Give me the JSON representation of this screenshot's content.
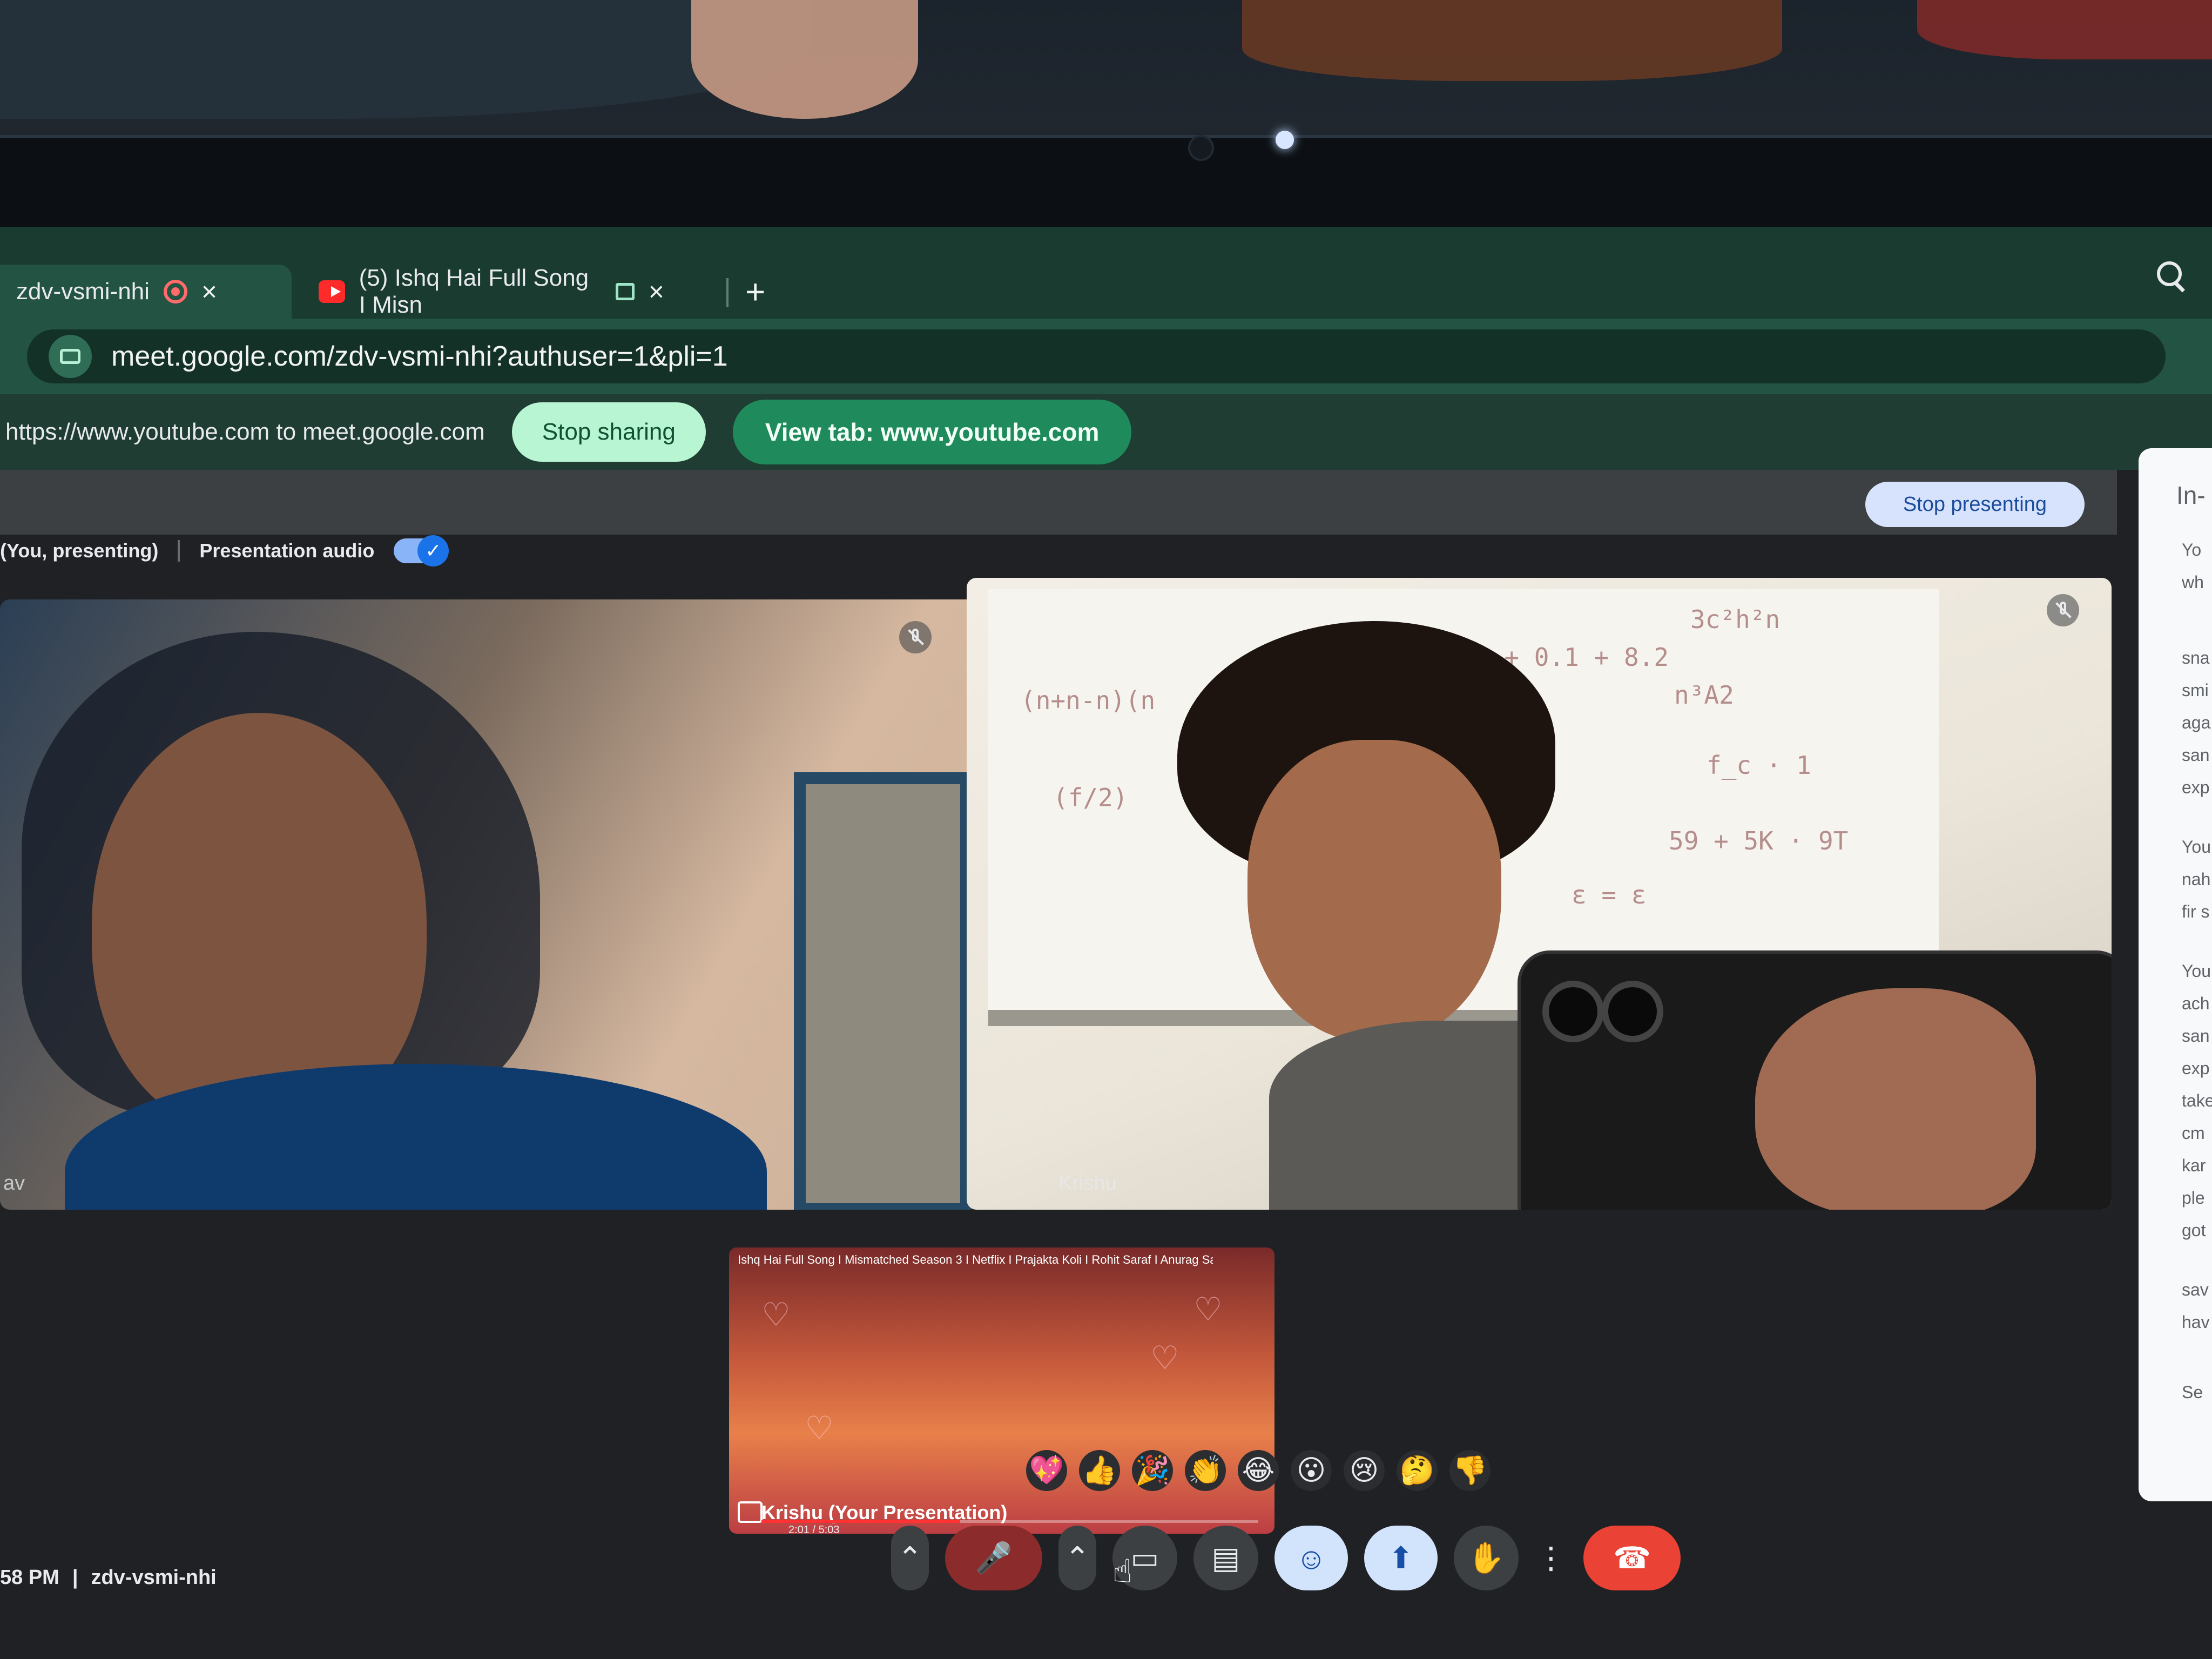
{
  "browser": {
    "tabs": [
      {
        "label": "zdv-vsmi-nhi",
        "active": true
      },
      {
        "label": "(5) Ishq Hai Full Song I Misn",
        "active": false
      }
    ],
    "url": "meet.google.com/zdv-vsmi-nhi?authuser=1&pli=1"
  },
  "share_bar": {
    "text": "https://www.youtube.com to meet.google.com",
    "stop_sharing_label": "Stop sharing",
    "view_tab_label": "View tab: www.youtube.com"
  },
  "meet": {
    "stop_presenting_label": "Stop presenting",
    "presenting_label": "(You, presenting)",
    "presentation_audio_label": "Presentation audio",
    "presentation_audio_on": true,
    "left_participant_name": "av",
    "right_participant_name": "Krishu",
    "thumbnail": {
      "title": "Ishq Hai Full Song I Mismatched Season 3 I Netflix I Prajakta Koli I Rohit Saraf I Anurag Sa...",
      "label": "Krishu (Your Presentation)",
      "time": "2:01 / 5:03",
      "progress": 0.4
    },
    "reactions": [
      "💖",
      "👍",
      "🎉",
      "👏",
      "😂",
      "😮",
      "😢",
      "🤔",
      "👎"
    ],
    "controls": {
      "mic": "mic-off",
      "camera": "camera",
      "captions": "captions",
      "emoji": "emoji",
      "present": "present",
      "hand": "raise-hand",
      "more": "more-options",
      "leave": "leave-call"
    },
    "bottom_time": "58 PM",
    "bottom_meeting_code": "zdv-vsmi-nhi",
    "side_panel": {
      "title": "In-",
      "lines": [
        "Yo",
        "wh",
        "sna",
        "smi",
        "aga",
        "san",
        "exp",
        "You",
        "nah",
        "fir s",
        "You",
        "ach",
        "san",
        "exp",
        "take",
        "cm",
        "kar",
        "ple",
        "got",
        "sav",
        "hav",
        "Se"
      ]
    }
  },
  "colors": {
    "tab_strip": "#1a3b2f",
    "toolbar": "#235343",
    "view_tab_button": "#1f8a5b",
    "stop_sharing_button": "#b8f5d3",
    "leave_button": "#ea4335",
    "meet_background": "#202124"
  }
}
